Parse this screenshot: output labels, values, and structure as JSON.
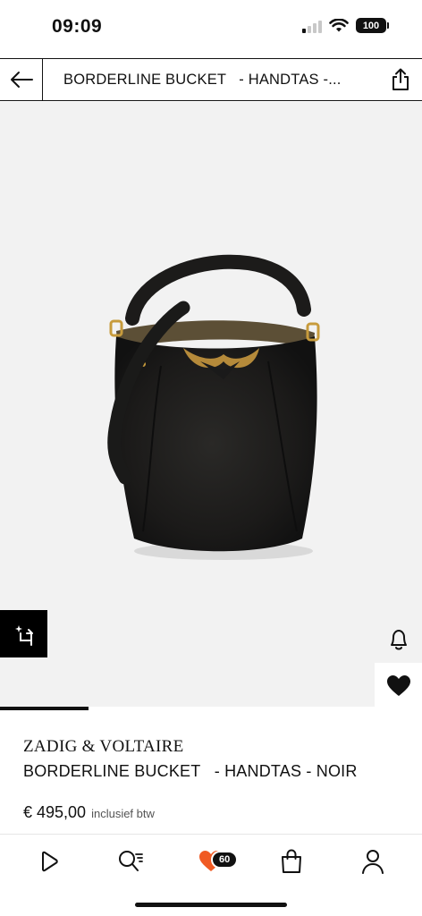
{
  "status_bar": {
    "time": "09:09",
    "battery": "100"
  },
  "header": {
    "title": "BORDERLINE BUCKET   - HANDTAS -..."
  },
  "gallery": {
    "progress": 0.21
  },
  "product": {
    "brand": "ZADIG & VOLTAIRE",
    "name": "BORDERLINE BUCKET   - HANDTAS - NOIR",
    "price": "€ 495,00",
    "tax_note": "inclusief btw"
  },
  "tab_bar": {
    "wishlist_count": "60"
  },
  "colors": {
    "accent": "#f05a23",
    "text": "#111111",
    "image_bg": "#f2f2f2"
  }
}
